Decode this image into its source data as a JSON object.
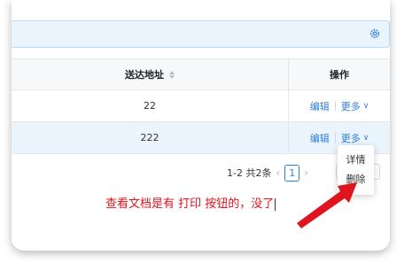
{
  "table": {
    "headers": {
      "address": "送达地址",
      "actions": "操作"
    },
    "rows": [
      {
        "address": "22",
        "edit": "编辑",
        "more": "更多"
      },
      {
        "address": "222",
        "edit": "编辑",
        "more": "更多"
      }
    ]
  },
  "pagination": {
    "summary": "1-2 共2条",
    "current_page": "1"
  },
  "dropdown": {
    "items": [
      "详情",
      "删除"
    ]
  },
  "annotation": {
    "text": "查看文档是有 打印 按钮的，没了"
  },
  "colors": {
    "link": "#2f7fd6",
    "annotation": "#e0141e",
    "selected_row": "#eaf4fd"
  },
  "icons": [
    "gear-icon",
    "sort-icon",
    "chevron-down-icon",
    "prev-page-icon",
    "next-page-icon",
    "arrow-annotation"
  ]
}
